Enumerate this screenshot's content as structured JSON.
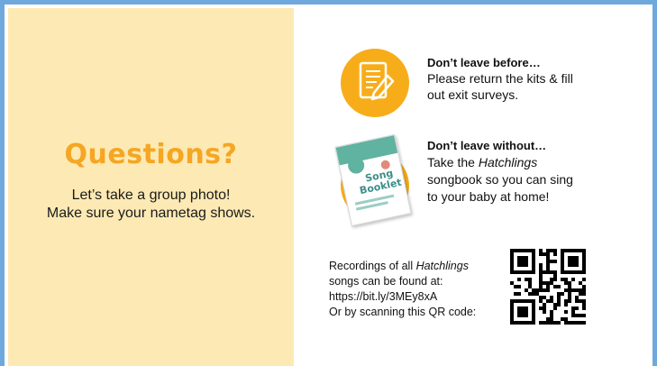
{
  "left_panel": {
    "title": "Questions?",
    "line1": "Let’s take a group photo!",
    "line2": "Make sure your nametag shows."
  },
  "before": {
    "heading": "Don’t leave before…",
    "line1": "Please return the kits & fill",
    "line2": "out exit surveys.",
    "icon": "clipboard-pencil-icon"
  },
  "without": {
    "heading": "Don’t leave without…",
    "line1_prefix": "Take the ",
    "line1_italic": "Hatchlings",
    "line2": "songbook so you can sing",
    "line3": "to your baby at home!",
    "booklet_title_line1": "Song",
    "booklet_title_line2": "Booklet"
  },
  "recordings": {
    "line1_prefix": "Recordings of all ",
    "line1_italic": "Hatchlings",
    "line2": "songs can be found at:",
    "url": "https://bit.ly/3MEy8xA",
    "line4": "Or by scanning this QR code:"
  },
  "colors": {
    "border": "#6fa8dc",
    "panel": "#fde9b4",
    "accent": "#f5a623",
    "circle": "#f7ad1a"
  }
}
